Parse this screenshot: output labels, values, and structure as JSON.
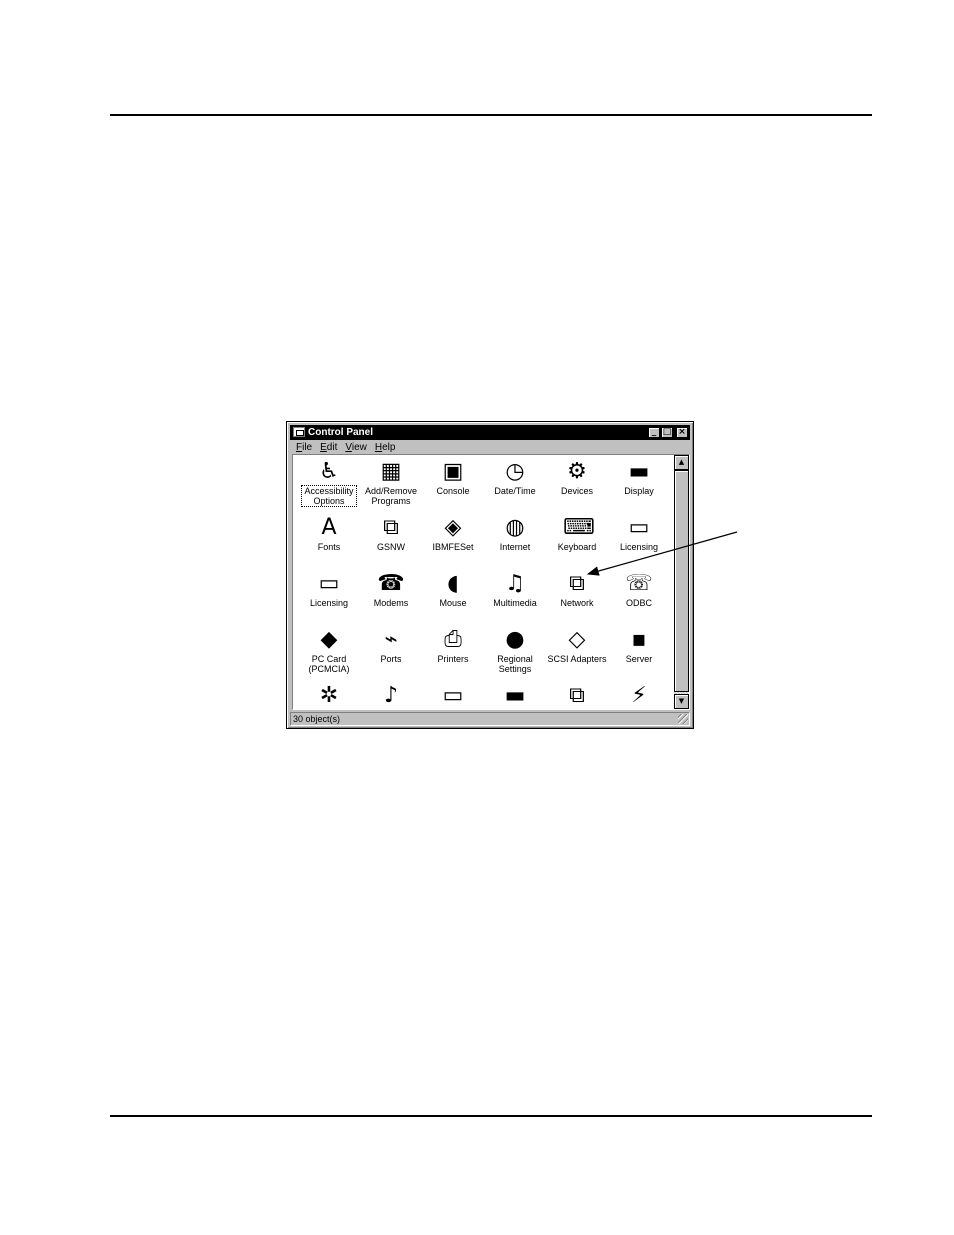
{
  "window": {
    "title": "Control Panel",
    "buttons": {
      "minimize": "_",
      "maximize": "□",
      "close": "×"
    }
  },
  "menu": [
    {
      "label": "File"
    },
    {
      "label": "Edit"
    },
    {
      "label": "View"
    },
    {
      "label": "Help"
    }
  ],
  "icons": [
    {
      "label": "Accessibility\nOptions",
      "icon": "wheelchair-icon",
      "glyph": "♿",
      "selected": true
    },
    {
      "label": "Add/Remove\nPrograms",
      "icon": "programs-icon",
      "glyph": "▦"
    },
    {
      "label": "Console",
      "icon": "ms-dos-icon",
      "glyph": "▣"
    },
    {
      "label": "Date/Time",
      "icon": "calendar-clock-icon",
      "glyph": "◷"
    },
    {
      "label": "Devices",
      "icon": "devices-icon",
      "glyph": "⚙"
    },
    {
      "label": "Display",
      "icon": "monitor-icon",
      "glyph": "▬"
    },
    {
      "label": "Fonts",
      "icon": "fonts-folder-icon",
      "glyph": "A"
    },
    {
      "label": "GSNW",
      "icon": "network-computers-icon",
      "glyph": "⧉"
    },
    {
      "label": "IBMFESet",
      "icon": "chip-icon",
      "glyph": "◈"
    },
    {
      "label": "Internet",
      "icon": "globe-icon",
      "glyph": "◍"
    },
    {
      "label": "Keyboard",
      "icon": "keyboard-icon",
      "glyph": "⌨"
    },
    {
      "label": "Licensing",
      "icon": "certificate-icon",
      "glyph": "▭"
    },
    {
      "label": "Licensing",
      "icon": "certificate-icon",
      "glyph": "▭"
    },
    {
      "label": "Modems",
      "icon": "phone-icon",
      "glyph": "☎"
    },
    {
      "label": "Mouse",
      "icon": "mouse-icon",
      "glyph": "◖"
    },
    {
      "label": "Multimedia",
      "icon": "multimedia-icon",
      "glyph": "♫"
    },
    {
      "label": "Network",
      "icon": "network-icon",
      "glyph": "⧉"
    },
    {
      "label": "ODBC",
      "icon": "odbc-icon",
      "glyph": "☏"
    },
    {
      "label": "PC Card\n(PCMCIA)",
      "icon": "pc-card-icon",
      "glyph": "◆"
    },
    {
      "label": "Ports",
      "icon": "ports-icon",
      "glyph": "⌁"
    },
    {
      "label": "Printers",
      "icon": "printer-folder-icon",
      "glyph": "⎙"
    },
    {
      "label": "Regional\nSettings",
      "icon": "globe-icon",
      "glyph": "●"
    },
    {
      "label": "SCSI Adapters",
      "icon": "scsi-icon",
      "glyph": "◇"
    },
    {
      "label": "Server",
      "icon": "server-icon",
      "glyph": "▪"
    },
    {
      "label": "",
      "icon": "services-icon",
      "glyph": "✲"
    },
    {
      "label": "",
      "icon": "sounds-icon",
      "glyph": "♪"
    },
    {
      "label": "",
      "icon": "system-icon",
      "glyph": "▭"
    },
    {
      "label": "",
      "icon": "tape-devices-icon",
      "glyph": "▬"
    },
    {
      "label": "",
      "icon": "telephony-icon",
      "glyph": "⧉"
    },
    {
      "label": "",
      "icon": "ups-icon",
      "glyph": "⚡"
    }
  ],
  "status": {
    "text": "30 object(s)"
  },
  "scrollbar": {
    "up": "▲",
    "down": "▼"
  },
  "colors": {
    "titlebar": "#000000",
    "chrome": "#c0c0c0",
    "client": "#ffffff"
  }
}
